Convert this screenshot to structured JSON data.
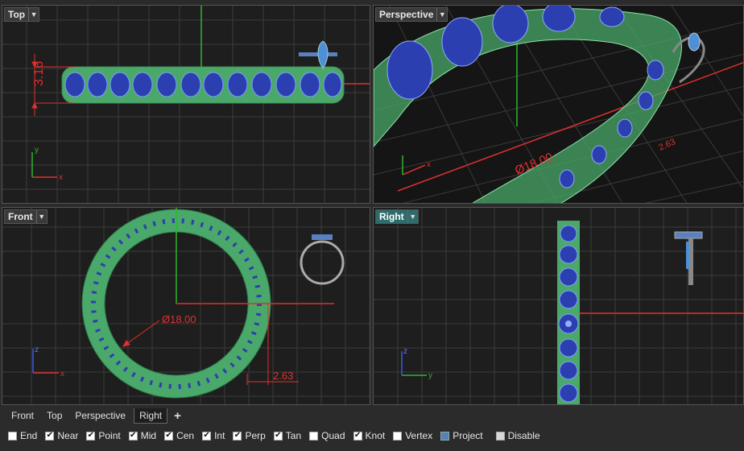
{
  "viewports": {
    "top": {
      "title": "Top",
      "dim_label": "3.16",
      "axis_x": "x",
      "axis_y": "y"
    },
    "perspective": {
      "title": "Perspective",
      "dim_diameter": "Ø18.00",
      "dim_width": "2.63",
      "axis_x": "x"
    },
    "front": {
      "title": "Front",
      "dim_diameter": "Ø18.00",
      "dim_width": "2.63",
      "axis_x": "x",
      "axis_z": "z"
    },
    "right": {
      "title": "Right",
      "axis_y": "y",
      "axis_z": "z"
    }
  },
  "tabs": [
    {
      "label": "Front",
      "active": false
    },
    {
      "label": "Top",
      "active": false
    },
    {
      "label": "Perspective",
      "active": false
    },
    {
      "label": "Right",
      "active": true
    }
  ],
  "tab_add": "+",
  "osnaps": [
    {
      "label": "End",
      "checked": false
    },
    {
      "label": "Near",
      "checked": true
    },
    {
      "label": "Point",
      "checked": true
    },
    {
      "label": "Mid",
      "checked": true
    },
    {
      "label": "Cen",
      "checked": true
    },
    {
      "label": "Int",
      "checked": true
    },
    {
      "label": "Perp",
      "checked": true
    },
    {
      "label": "Tan",
      "checked": true
    },
    {
      "label": "Quad",
      "checked": false
    },
    {
      "label": "Knot",
      "checked": true
    },
    {
      "label": "Vertex",
      "checked": false
    },
    {
      "label": "Project",
      "checked": true
    },
    {
      "label": "Disable",
      "checked": false
    }
  ],
  "colors": {
    "grid": "#3c3c3c",
    "axis_red": "#e03030",
    "axis_green": "#2fb52f",
    "ring_green": "#4aa86a",
    "stone_blue": "#2c3fb0",
    "active_tab": "#2e6b6b"
  }
}
